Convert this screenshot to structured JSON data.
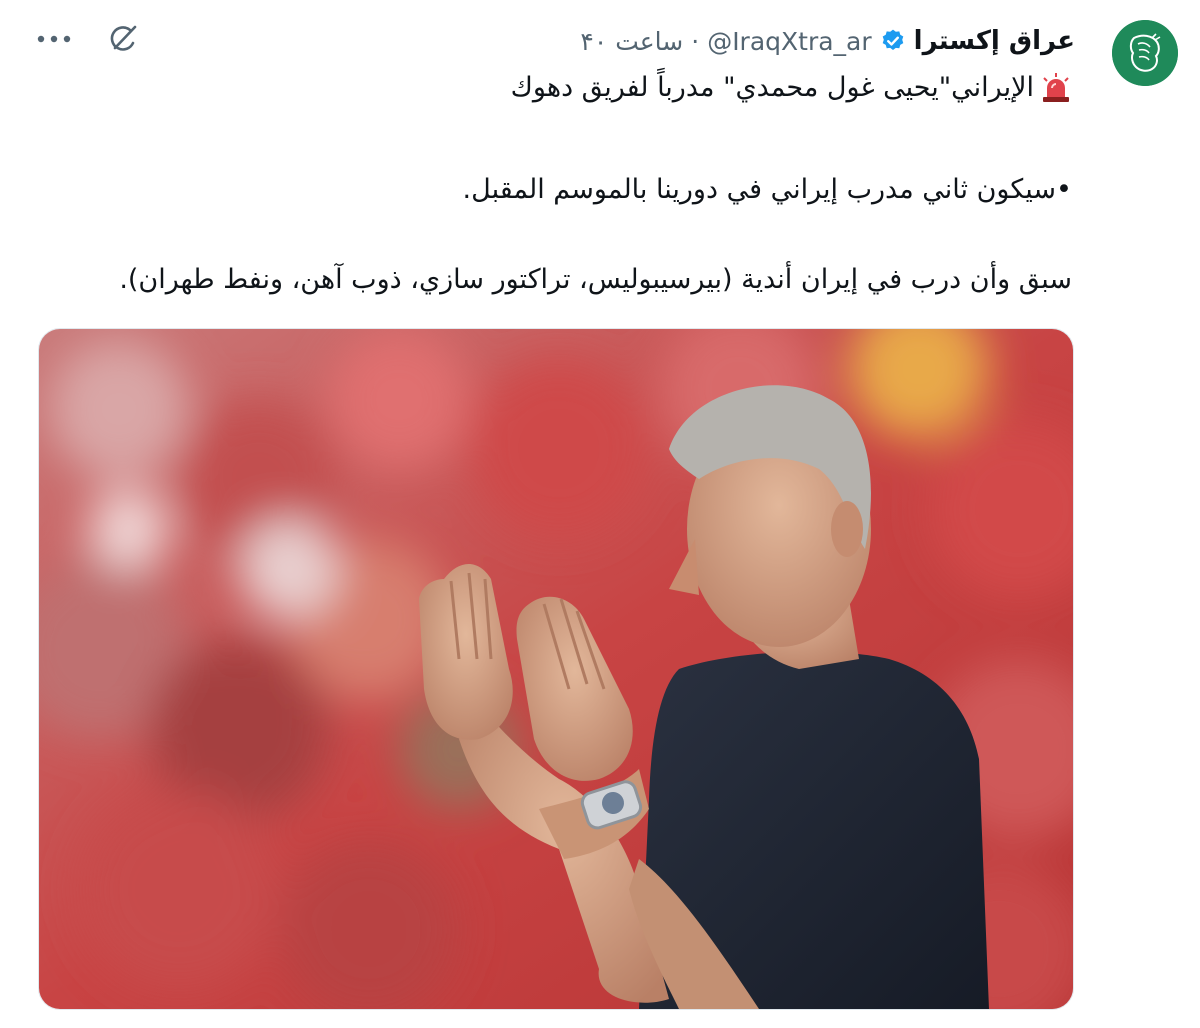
{
  "tweet": {
    "display_name": "عراق إكسترا",
    "handle": "@IraqXtra_ar",
    "separator": "·",
    "timestamp": "۴۰ ساعت",
    "text_line1": "الإيراني\"يحيى غول محمدي\" مدرباً لفريق دهوك",
    "text_line2": "•سيكون ثاني مدرب إيراني في دورينا بالموسم المقبل.",
    "text_line3": "سبق وأن درب في إيران أندية (بيرسيبوليس، تراكتور سازي، ذوب آهن، ونفط طهران).",
    "icons": {
      "avatar": "iraq-xtra-logo",
      "verified": "verified-badge-icon",
      "siren": "police-siren-icon",
      "grok": "grok-icon",
      "more": "more-options-icon"
    }
  },
  "colors": {
    "brand_green": "#1f8a5a",
    "verified_blue": "#1d9bf0",
    "secondary_text": "#536471",
    "primary_text": "#0f1419"
  }
}
